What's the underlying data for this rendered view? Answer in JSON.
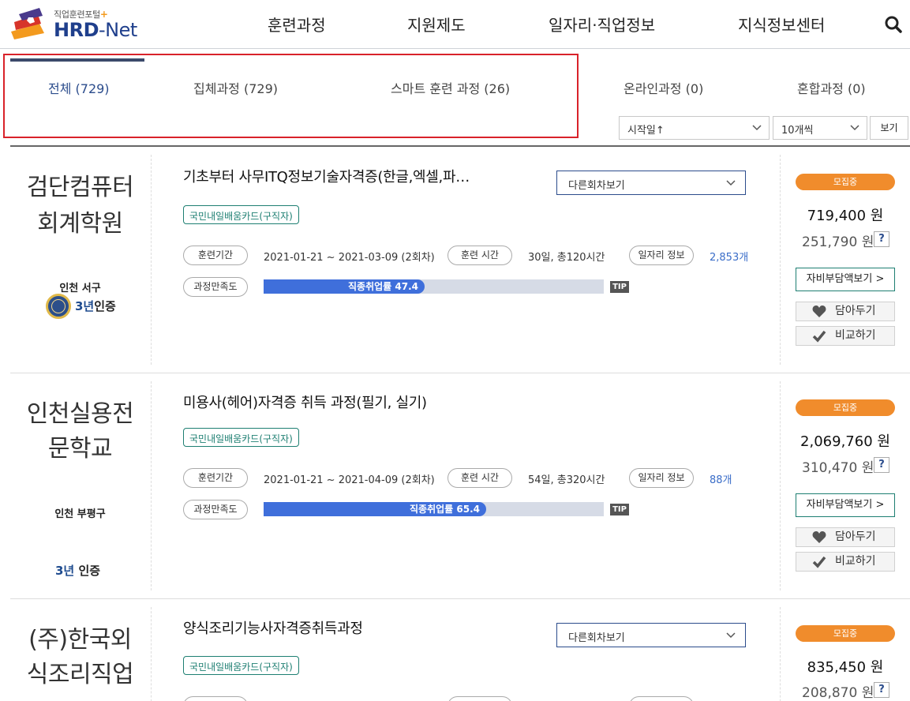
{
  "header": {
    "logo_sub": "직업훈련포털",
    "logo_plus": "+",
    "logo_main": "HRD",
    "logo_net": "-Net",
    "nav": [
      "훈련과정",
      "지원제도",
      "일자리·직업정보",
      "지식정보센터"
    ],
    "search_icon": "search-icon"
  },
  "tabs": [
    {
      "label": "전체 (729)",
      "active": true
    },
    {
      "label": "집체과정 (729)"
    },
    {
      "label": "스마트 훈련 과정 (26)"
    },
    {
      "label": "온라인과정 (0)"
    },
    {
      "label": "혼합과정 (0)"
    }
  ],
  "filters": {
    "sort": "시작일↑",
    "per_page": "10개씩",
    "view_button": "보기"
  },
  "courses": [
    {
      "inst_line1": "검단컴퓨터",
      "inst_line2": "회계학원",
      "location": "인천 서구",
      "cert_num": "3년",
      "cert_text": "인증",
      "title": "기초부터 사무ITQ정보기술자격증(한글,엑셀,파…",
      "other_round": "다른회차보기",
      "tag": "국민내일배움카드(구직자)",
      "period_label": "훈련기간",
      "period": "2021-01-21 ~ 2021-03-09 (2회차)",
      "hours_label": "훈련 시간",
      "hours": "30일, 총120시간",
      "jobs_label": "일자리 정보",
      "jobs": "2,853개",
      "satisfaction_label": "과정만족도",
      "employment_label": "직종취업률 47.4",
      "employment_rate": 47.4,
      "tip": "TIP",
      "status": "모집중",
      "price": "719,400 원",
      "self_pay": "251,790 원",
      "q": "?",
      "self_pay_btn": "자비부담액보기 >",
      "save_btn": "담아두기",
      "compare_btn": "비교하기"
    },
    {
      "inst_line1": "인천실용전",
      "inst_line2": "문학교",
      "location": "인천 부평구",
      "cert_num": "3년",
      "cert_text": " 인증",
      "title": "미용사(헤어)자격증 취득 과정(필기, 실기)",
      "tag": "국민내일배움카드(구직자)",
      "period_label": "훈련기간",
      "period": "2021-01-21 ~ 2021-04-09 (2회차)",
      "hours_label": "훈련 시간",
      "hours": "54일, 총320시간",
      "jobs_label": "일자리 정보",
      "jobs": "88개",
      "satisfaction_label": "과정만족도",
      "employment_label": "직종취업률 65.4",
      "employment_rate": 65.4,
      "tip": "TIP",
      "status": "모집중",
      "price": "2,069,760 원",
      "self_pay": "310,470 원",
      "q": "?",
      "self_pay_btn": "자비부담액보기 >",
      "save_btn": "담아두기",
      "compare_btn": "비교하기"
    },
    {
      "inst_line1": "(주)한국외",
      "inst_line2": "식조리직업",
      "title": "양식조리기능사자격증취득과정",
      "other_round": "다른회차보기",
      "tag": "국민내일배움카드(구직자)",
      "status": "모집중",
      "price": "835,450 원",
      "self_pay": "208,870 원",
      "q": "?"
    }
  ],
  "colors": {
    "brand": "#1f3f8c",
    "accent_orange": "#f08c2c",
    "bar": "#3f6fdb",
    "tag_green": "#1e7f72",
    "highlight_red": "#d9222a"
  }
}
